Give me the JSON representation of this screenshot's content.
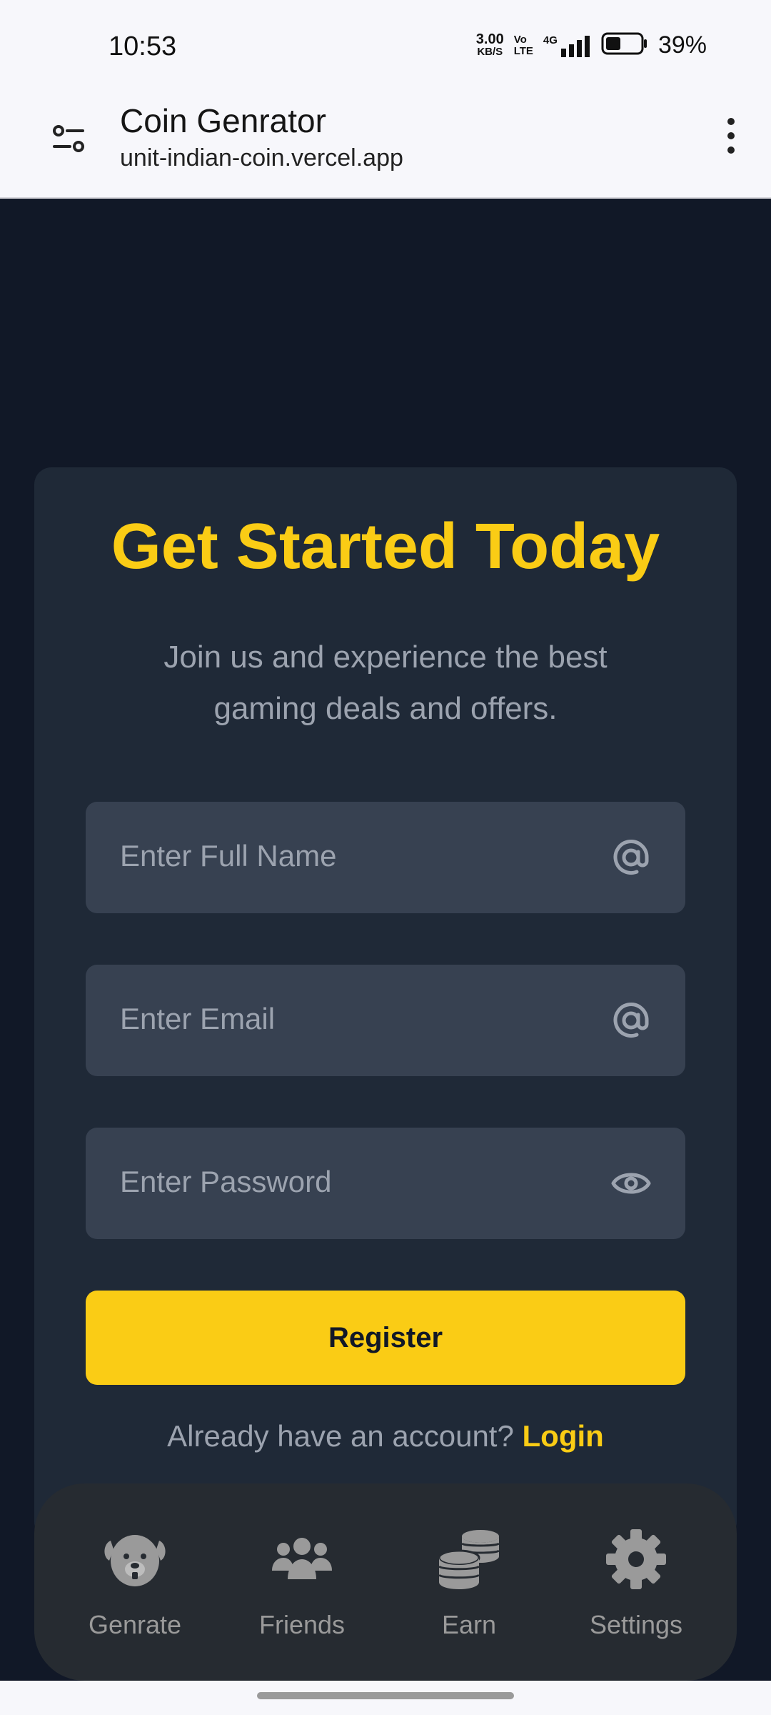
{
  "status_bar": {
    "time": "10:53",
    "net_speed_value": "3.00",
    "net_speed_unit": "KB/S",
    "volte_top": "Vo",
    "volte_bottom": "LTE",
    "network": "4G",
    "battery_percent": "39%"
  },
  "browser": {
    "title": "Coin Genrator",
    "url": "unit-indian-coin.vercel.app"
  },
  "register_card": {
    "title": "Get Started Today",
    "subtitle": "Join us and experience the best gaming deals and offers.",
    "name_placeholder": "Enter Full Name",
    "email_placeholder": "Enter Email",
    "password_placeholder": "Enter Password",
    "register_label": "Register",
    "login_prompt": "Already have an account?",
    "login_label": "Login"
  },
  "bottom_nav": {
    "items": [
      {
        "label": "Genrate",
        "icon": "dog-icon"
      },
      {
        "label": "Friends",
        "icon": "users-icon"
      },
      {
        "label": "Earn",
        "icon": "coins-icon"
      },
      {
        "label": "Settings",
        "icon": "gear-icon"
      }
    ]
  },
  "colors": {
    "background": "#111827",
    "card": "#1f2937",
    "input": "#374151",
    "accent": "#facc15",
    "muted_text": "#9ca3af",
    "nav": "#262b31"
  }
}
